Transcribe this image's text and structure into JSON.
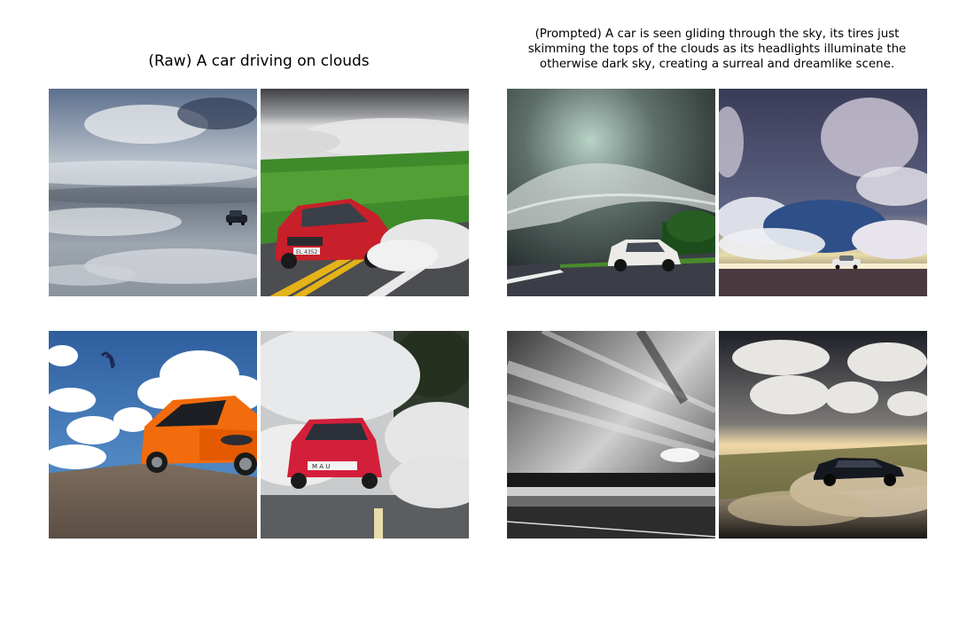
{
  "figure": {
    "raw_panel": {
      "title": "(Raw) A car driving on clouds"
    },
    "prompted_panel": {
      "title": "(Prompted) A car is seen gliding through the sky, its tires just skimming the tops of the clouds as its headlights illuminate the otherwise dark sky, creating a surreal and dreamlike scene."
    },
    "license_plates": {
      "raw_top_right": "EL 4352",
      "raw_bottom_right": "M A U"
    }
  }
}
